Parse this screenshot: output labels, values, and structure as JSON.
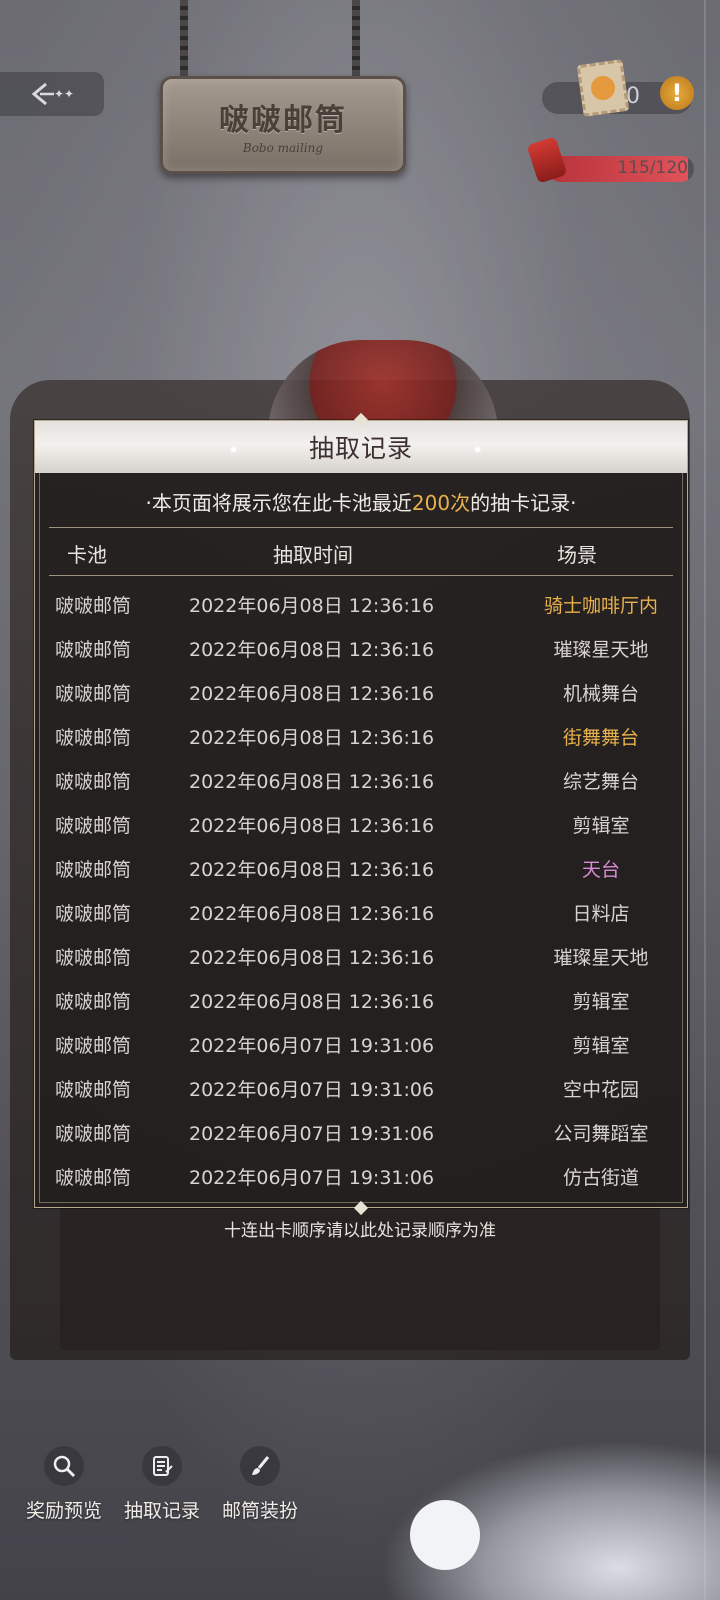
{
  "sign": {
    "title": "啵啵邮筒",
    "subtitle": "Bobo mailing"
  },
  "status": {
    "stamps": "0",
    "energy": "115/120",
    "energy_ratio": 0.958
  },
  "dialog": {
    "title": "抽取记录",
    "notice_prefix": "·本页面将展示您在此卡池最近",
    "notice_highlight": "200次",
    "notice_suffix": "的抽卡记录·",
    "columns": [
      "卡池",
      "抽取时间",
      "场景"
    ],
    "rows": [
      {
        "pool": "啵啵邮筒",
        "time": "2022年06月08日 12:36:16",
        "scene": "骑士咖啡厅内",
        "color": "#e8b14c"
      },
      {
        "pool": "啵啵邮筒",
        "time": "2022年06月08日 12:36:16",
        "scene": "璀璨星天地",
        "color": "#d7d3ce"
      },
      {
        "pool": "啵啵邮筒",
        "time": "2022年06月08日 12:36:16",
        "scene": "机械舞台",
        "color": "#d7d3ce"
      },
      {
        "pool": "啵啵邮筒",
        "time": "2022年06月08日 12:36:16",
        "scene": "街舞舞台",
        "color": "#e8b14c"
      },
      {
        "pool": "啵啵邮筒",
        "time": "2022年06月08日 12:36:16",
        "scene": "综艺舞台",
        "color": "#d7d3ce"
      },
      {
        "pool": "啵啵邮筒",
        "time": "2022年06月08日 12:36:16",
        "scene": "剪辑室",
        "color": "#d7d3ce"
      },
      {
        "pool": "啵啵邮筒",
        "time": "2022年06月08日 12:36:16",
        "scene": "天台",
        "color": "#d98ad8"
      },
      {
        "pool": "啵啵邮筒",
        "time": "2022年06月08日 12:36:16",
        "scene": "日料店",
        "color": "#d7d3ce"
      },
      {
        "pool": "啵啵邮筒",
        "time": "2022年06月08日 12:36:16",
        "scene": "璀璨星天地",
        "color": "#d7d3ce"
      },
      {
        "pool": "啵啵邮筒",
        "time": "2022年06月08日 12:36:16",
        "scene": "剪辑室",
        "color": "#d7d3ce"
      },
      {
        "pool": "啵啵邮筒",
        "time": "2022年06月07日 19:31:06",
        "scene": "剪辑室",
        "color": "#d7d3ce"
      },
      {
        "pool": "啵啵邮筒",
        "time": "2022年06月07日 19:31:06",
        "scene": "空中花园",
        "color": "#d7d3ce"
      },
      {
        "pool": "啵啵邮筒",
        "time": "2022年06月07日 19:31:06",
        "scene": "公司舞蹈室",
        "color": "#d7d3ce"
      },
      {
        "pool": "啵啵邮筒",
        "time": "2022年06月07日 19:31:06",
        "scene": "仿古街道",
        "color": "#d7d3ce"
      }
    ],
    "footer": "十连出卡顺序请以此处记录顺序为准"
  },
  "nav": [
    {
      "label": "奖励预览",
      "icon": "magnifier-icon"
    },
    {
      "label": "抽取记录",
      "icon": "notepad-icon"
    },
    {
      "label": "邮筒装扮",
      "icon": "brush-icon"
    }
  ]
}
